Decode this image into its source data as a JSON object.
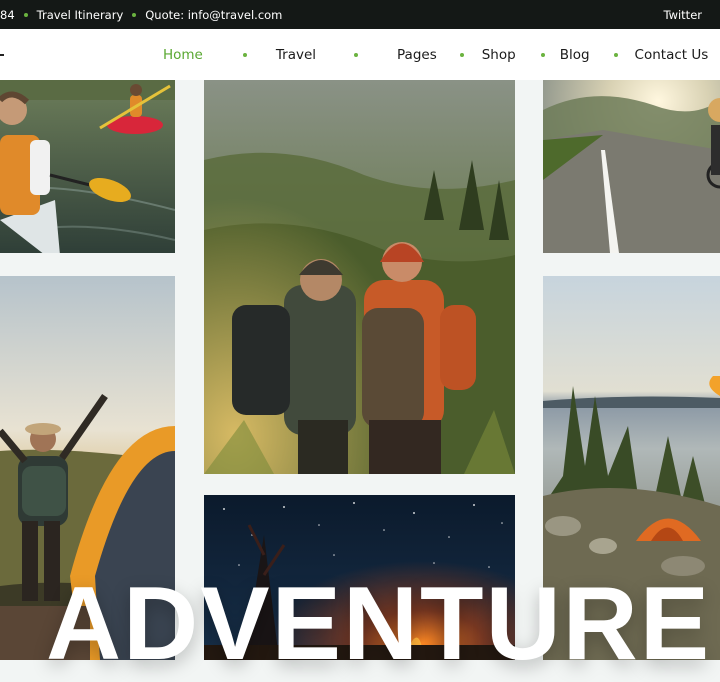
{
  "topbar": {
    "phone_fragment": "84",
    "itinerary": "Travel Itinerary",
    "quote": "Quote: info@travel.com",
    "twitter": "Twitter"
  },
  "nav": {
    "items": [
      "Home",
      "Travel",
      "Pages",
      "Shop",
      "Blog",
      "Contact Us"
    ],
    "active": "Home"
  },
  "gallery": {
    "headline": "ADVENTURE",
    "photos": [
      "kayakers-on-lake",
      "hikers-on-mountain",
      "sunlit-road-cyclist",
      "hiker-raising-arms-by-tent",
      "campfire-under-stars",
      "lake-campsite-at-sunset"
    ]
  },
  "colors": {
    "accent": "#5aa832",
    "topbar_bg": "#141816",
    "page_bg": "#f2f5f4"
  }
}
